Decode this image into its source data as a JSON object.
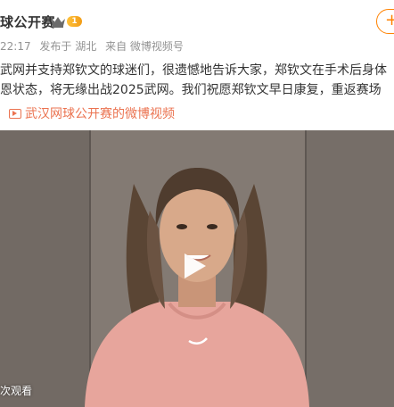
{
  "post": {
    "account_name": "球公开赛",
    "level_badge": "1",
    "follow_label": "+",
    "time": "22:17",
    "location": "发布于 湖北",
    "source": "来自 微博视频号",
    "text_lines": [
      "武网并支持郑钦文的球迷们，很遗憾地告诉大家，郑钦文在手术后身体",
      "恩状态，将无缘出战2025武网。我们祝愿郑钦文早日康复，重返赛场"
    ],
    "video_link_label": "武汉网球公开赛的微博视频"
  },
  "video": {
    "watch_label": "次观看",
    "icons": [
      "crown-icon",
      "play-icon",
      "video-link-icon"
    ]
  },
  "colors": {
    "accent": "#ff8200",
    "link": "#eb7350",
    "meta": "#939393",
    "wall": "#7b736d",
    "sweater": "#e7a59c"
  }
}
